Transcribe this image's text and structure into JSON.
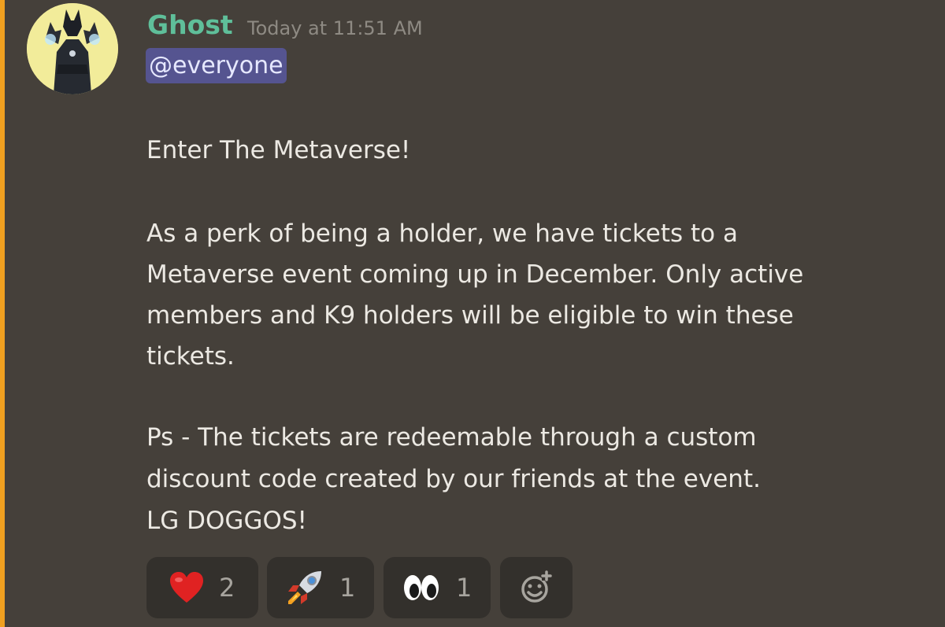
{
  "message": {
    "author": "Ghost",
    "timestamp": "Today at 11:51 AM",
    "mention": "@everyone",
    "lines": [
      "Enter The Metaverse!",
      "As a perk of being a holder, we have tickets to a",
      "Metaverse event coming up in December. Only active",
      "members and K9 holders will be eligible to win these",
      "tickets.",
      "Ps - The tickets are redeemable through a custom",
      "discount code created by our friends at the event.",
      "LG DOGGOS!"
    ]
  },
  "reactions": [
    {
      "emoji": "heart-icon",
      "count": "2"
    },
    {
      "emoji": "rocket-icon",
      "count": "1"
    },
    {
      "emoji": "eyes-icon",
      "count": "1"
    },
    {
      "emoji": "add-reaction-icon"
    }
  ],
  "colors": {
    "background": "#45403a",
    "mention_highlight_bar": "#f0a020",
    "username": "#5fbf9a",
    "mention_pill": "#555490",
    "reaction_bg": "#33302c"
  }
}
